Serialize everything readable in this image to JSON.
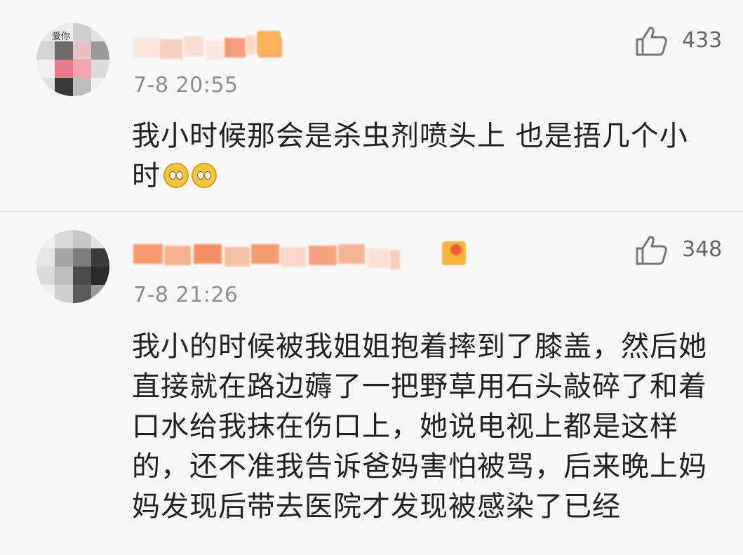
{
  "comments": [
    {
      "time": "7-8 20:55",
      "likes": "433",
      "avatar_text": "爱你",
      "text_line1": "我小时候那会是杀虫剂喷头上 也是捂几个小",
      "text_line2": "时",
      "emojis": [
        "smile-emoji",
        "smile-emoji"
      ]
    },
    {
      "time": "7-8 21:26",
      "likes": "348",
      "text_line1": "我小的时候被我姐姐抱着摔到了膝盖，然后她",
      "text_line2": "直接就在路边薅了一把野草用石头敲碎了和着",
      "text_line3": "口水给我抹在伤口上，她说电视上都是这样",
      "text_line4": "的，还不准我告诉爸妈害怕被骂，后来晚上妈",
      "text_line5": "妈发现后带去医院才发现被感染了已经"
    }
  ],
  "icons": {
    "like": "thumbs-up-icon"
  },
  "colors": {
    "background": "#f7f7f7",
    "text": "#222222",
    "time": "#8f8f8f",
    "badge": "#f5a623"
  }
}
